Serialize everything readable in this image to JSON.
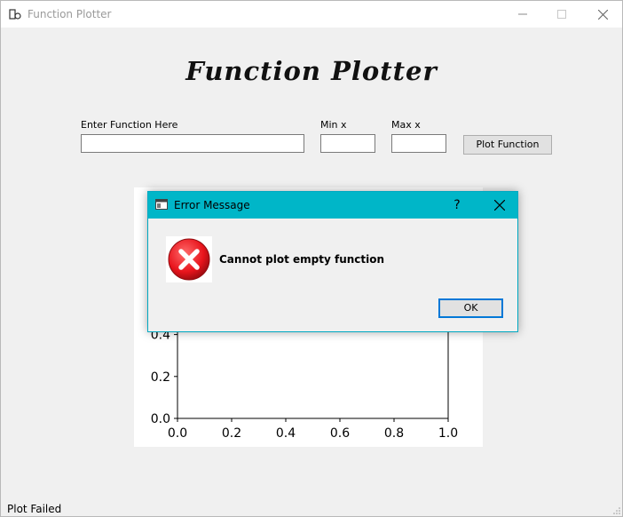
{
  "window": {
    "title": "Function Plotter",
    "controls": [
      "minimize-icon",
      "maximize-icon",
      "close-icon"
    ]
  },
  "app_heading": "Function Plotter",
  "form": {
    "function_label": "Enter Function Here",
    "function_value": "",
    "minx_label": "Min x",
    "minx_value": "",
    "maxx_label": "Max x",
    "maxx_value": "",
    "plot_button": "Plot Function"
  },
  "plot": {
    "type": "line",
    "x_ticks": [
      "0.0",
      "0.2",
      "0.4",
      "0.6",
      "0.8",
      "1.0"
    ],
    "y_ticks_visible": [
      "0.0",
      "0.2",
      "0.4"
    ],
    "xlim": [
      0,
      1
    ],
    "ylim": [
      0,
      1
    ]
  },
  "status_bar": "Plot Failed",
  "dialog": {
    "title": "Error Message",
    "help_glyph": "?",
    "icon": "error-icon",
    "message": "Cannot plot empty function",
    "ok_button": "OK"
  },
  "colors": {
    "dialog_titlebar": "#00b6c8",
    "ok_focus": "#0078d7",
    "error_red": "#e8141c"
  }
}
